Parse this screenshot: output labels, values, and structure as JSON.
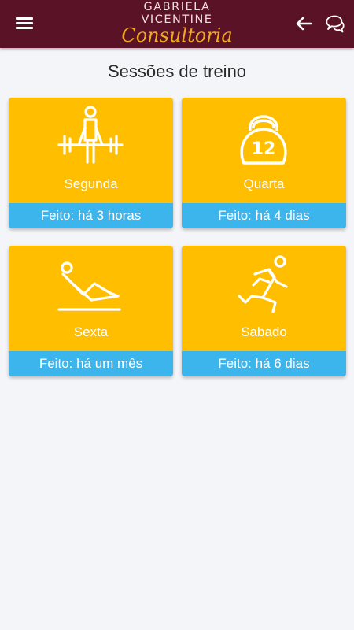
{
  "header": {
    "logo_line1": "GABRIELA",
    "logo_line2": "VICENTINE",
    "logo_line3": "Consultoria",
    "menu_icon": "hamburger-menu-icon",
    "back_icon": "arrow-left-icon",
    "chat_icon": "chat-bubbles-icon"
  },
  "page": {
    "title": "Sessões de treino"
  },
  "sessions": [
    {
      "day": "Segunda",
      "status": "Feito: há 3 horas",
      "icon": "weightlifter-icon"
    },
    {
      "day": "Quarta",
      "status": "Feito: há 4 dias",
      "icon": "kettlebell-icon",
      "icon_text": "12"
    },
    {
      "day": "Sexta",
      "status": "Feito: há um mês",
      "icon": "stretching-icon"
    },
    {
      "day": "Sabado",
      "status": "Feito: há 6 dias",
      "icon": "running-icon"
    }
  ],
  "colors": {
    "appbar": "#5a1226",
    "card": "#ffbf00",
    "status_bar": "#3cb4ec",
    "logo_accent": "#f4a91d",
    "background": "#f4f5f9"
  }
}
